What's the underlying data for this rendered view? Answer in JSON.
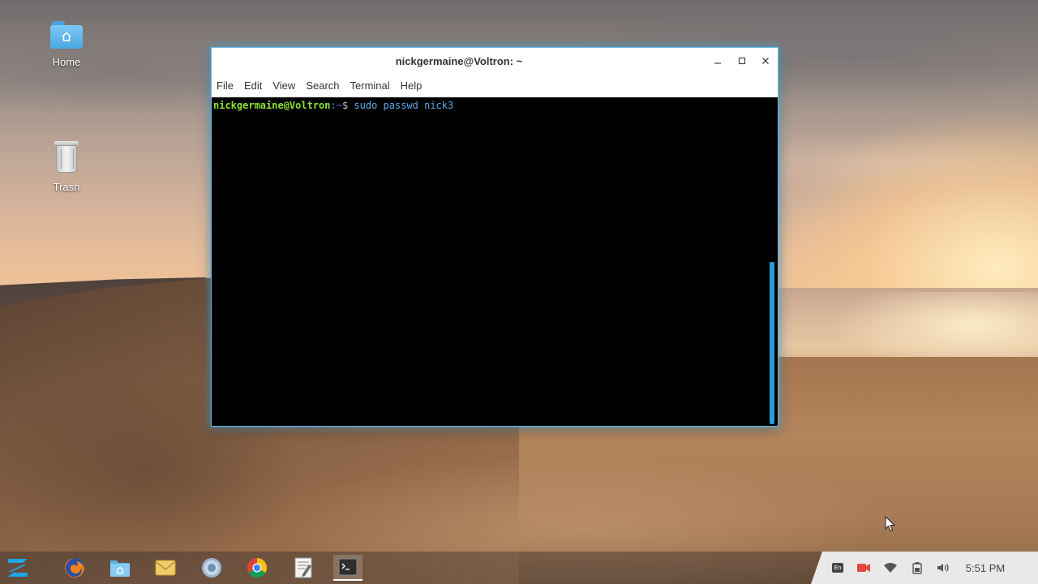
{
  "desktop": {
    "icons": [
      {
        "label": "Home",
        "icon": "home-folder-icon"
      },
      {
        "label": "Trash",
        "icon": "trash-bin-icon"
      }
    ]
  },
  "window": {
    "title": "nickgermaine@Voltron: ~",
    "controls": {
      "minimize": "minimize-icon",
      "maximize": "maximize-icon",
      "close": "close-icon"
    },
    "menu": [
      "File",
      "Edit",
      "View",
      "Search",
      "Terminal",
      "Help"
    ]
  },
  "terminal": {
    "prompt_user": "nickgermaine@Voltron",
    "prompt_path": ":~",
    "prompt_symbol": "$",
    "command": " sudo passwd nick3"
  },
  "taskbar": {
    "menu_button": "zorin-menu-icon",
    "apps": [
      "firefox-icon",
      "files-icon",
      "mail-icon",
      "web-browser-icon",
      "chrome-icon",
      "text-editor-icon",
      "terminal-icon"
    ],
    "active_app": "terminal-icon",
    "tray": {
      "keyboard_layout": "En",
      "clock": "5:51 PM"
    }
  },
  "colors": {
    "window_glow": "#64b9e8",
    "prompt_user": "#8ae234",
    "prompt_path": "#3465a4",
    "command": "#5aa9e6",
    "scrollbar": "#2a9ad8"
  }
}
